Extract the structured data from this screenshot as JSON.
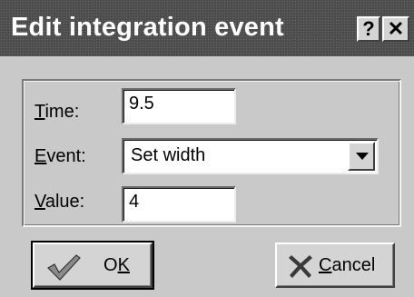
{
  "window": {
    "title": "Edit integration event",
    "help_label": "?",
    "close_label": "✕"
  },
  "form": {
    "time": {
      "label_key": "T",
      "label_rest": "ime:",
      "value": "9.5"
    },
    "event": {
      "label_key": "E",
      "label_rest": "vent:",
      "value": "Set width"
    },
    "value": {
      "label_key": "V",
      "label_rest": "alue:",
      "value": "4"
    }
  },
  "buttons": {
    "ok": {
      "label_pre": "O",
      "label_key": "K",
      "icon": "checkmark-icon"
    },
    "cancel": {
      "label_key": "C",
      "label_rest": "ancel",
      "icon": "cross-icon"
    }
  }
}
